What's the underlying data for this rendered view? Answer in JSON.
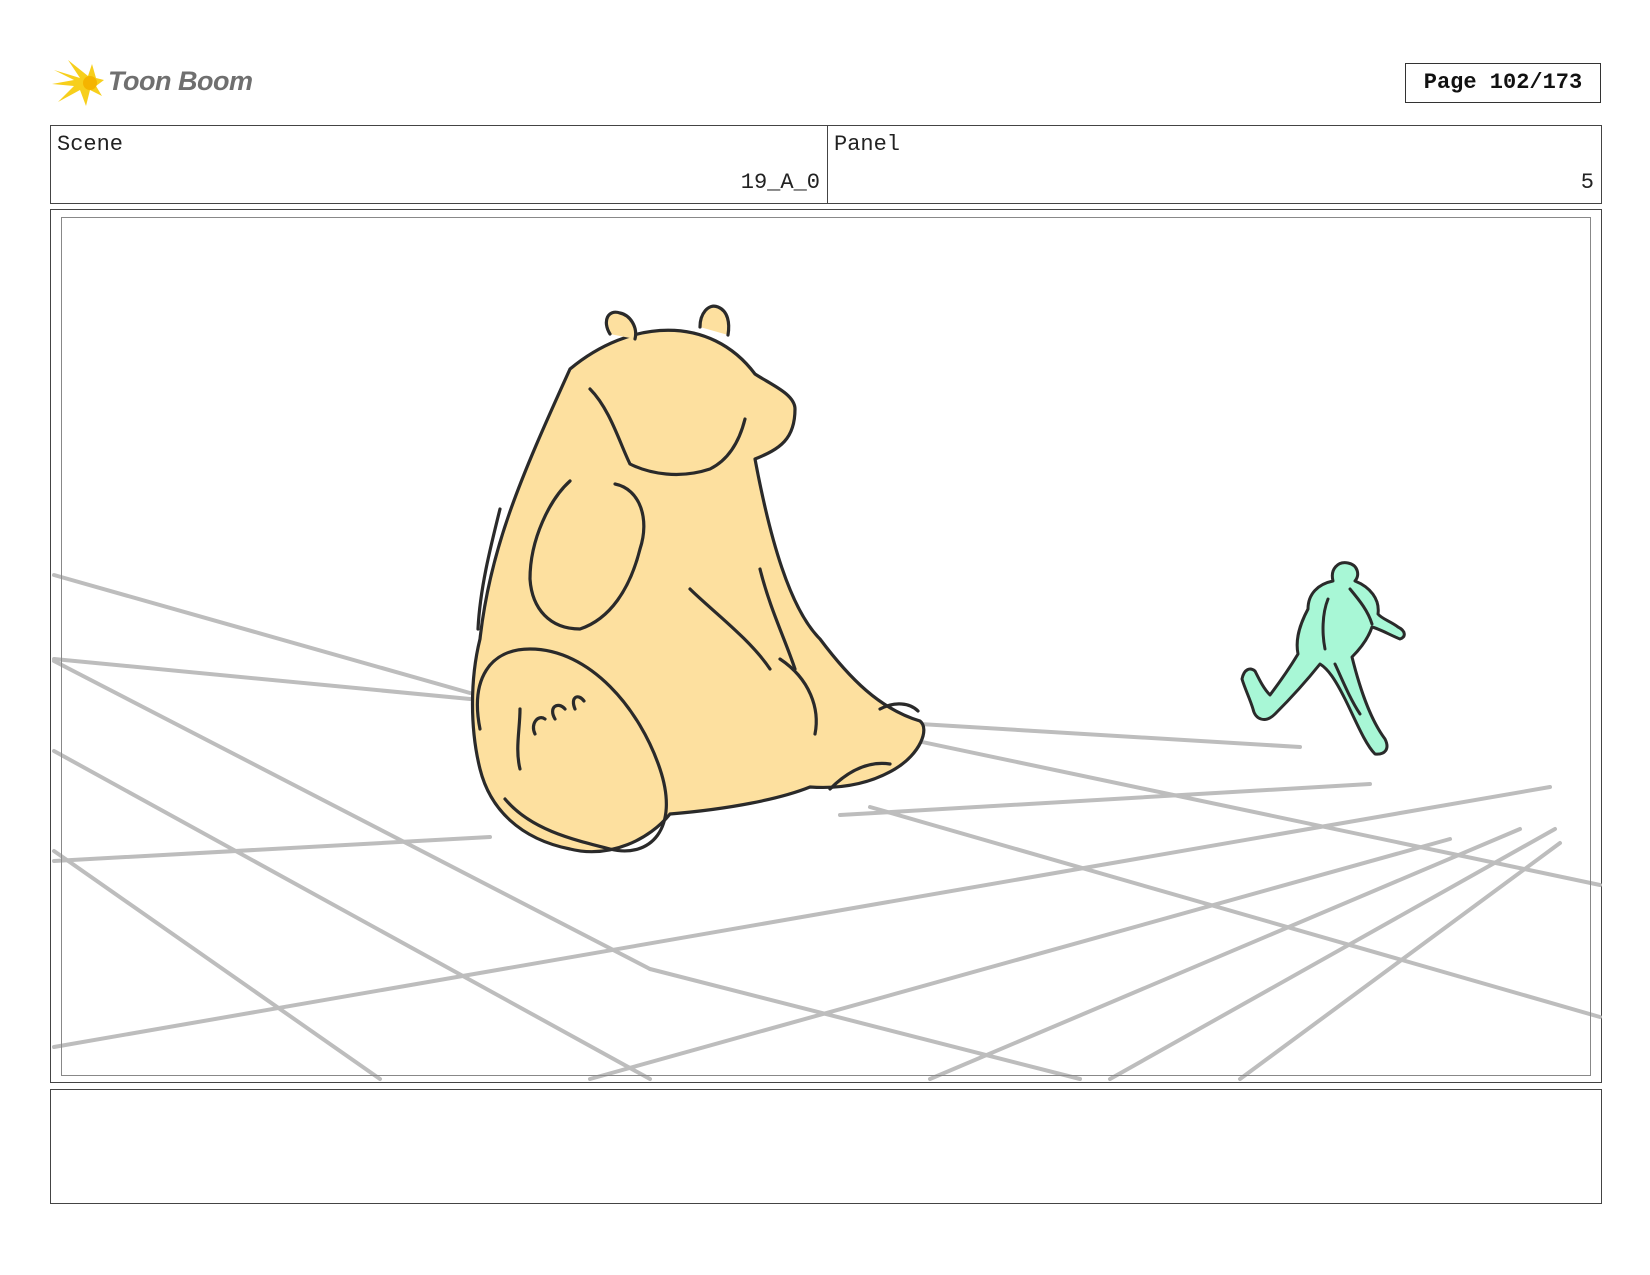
{
  "header": {
    "logo_text": "Toon Boom",
    "page_label": "Page 102/173"
  },
  "info": {
    "scene_label": "Scene",
    "scene_value": "19_A_0",
    "panel_label": "Panel",
    "panel_value": "5"
  },
  "colors": {
    "bear_fill": "#fde09f",
    "runner_fill": "#a8f7d6",
    "grid_lines": "#bdbdbd",
    "ink": "#2a2a2a",
    "logo_yellow": "#f7cf1c"
  },
  "notes": {
    "text": ""
  }
}
